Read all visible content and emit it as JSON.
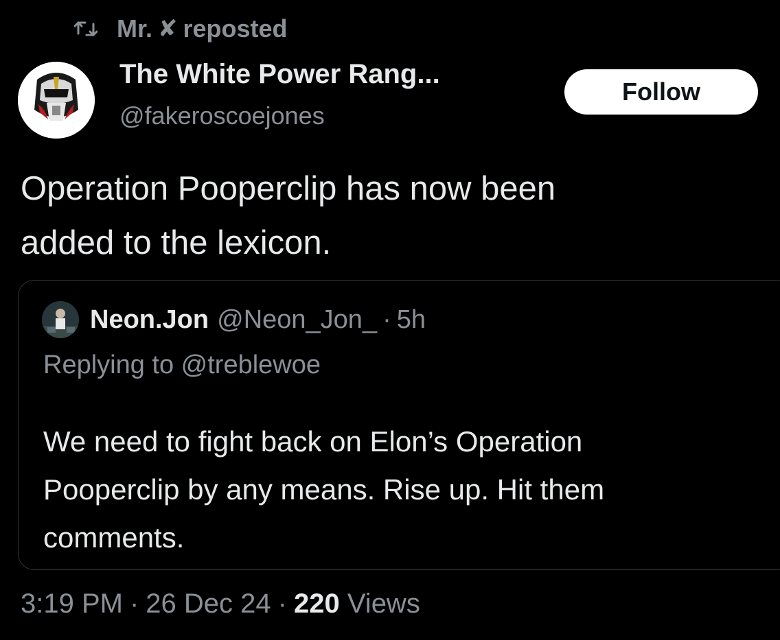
{
  "repost": {
    "icon": "repost-icon",
    "user": "Mr.",
    "badge_icon": "x-logo-icon",
    "label": "reposted"
  },
  "author": {
    "name": "The White Power Rang...",
    "handle": "@fakeroscoejones",
    "avatar_icon": "white-ranger-helmet-avatar"
  },
  "follow_label": "Follow",
  "tweet": {
    "line1": "Operation Pooperclip has now been",
    "line2": "added to the lexicon."
  },
  "quote": {
    "name": "Neon.Jon",
    "handle": "@Neon_Jon_",
    "dot": "·",
    "time": "5h",
    "replying": "Replying to @treblewoe",
    "line1": "We need to fight back on Elon’s Operation",
    "line2": "Pooperclip by any means. Rise up. Hit them",
    "line3": "comments."
  },
  "meta": {
    "time": "3:19 PM",
    "date": "26 Dec 24",
    "views_count": "220",
    "views_label": "Views",
    "sep": "·"
  },
  "colors": {
    "background": "#000000",
    "text": "#e7e9ea",
    "secondary": "#8b9096",
    "border": "#2f3336",
    "follow_bg": "#ffffff"
  }
}
